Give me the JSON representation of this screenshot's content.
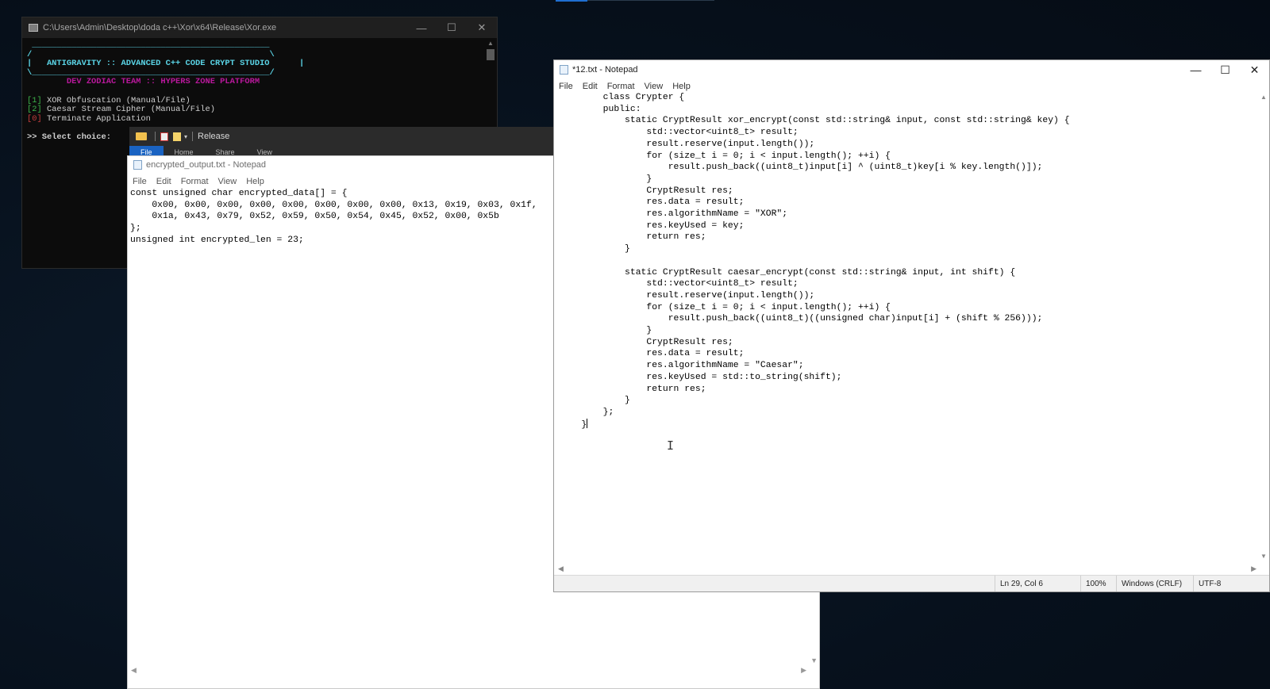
{
  "console": {
    "title": "C:\\Users\\Admin\\Desktop\\doda c++\\Xor\\x64\\Release\\Xor.exe",
    "banner_top": " ________________________________________________ ",
    "banner_line": "/                                                \\",
    "banner_title": "|   ANTIGRAVITY :: ADVANCED C++ CODE CRYPT STUDIO      |",
    "banner_bottom": "\\________________________________________________/",
    "subtitle": "        DEV ZODIAC TEAM :: HYPERS ZONE PLATFORM",
    "options": [
      {
        "key": "[1]",
        "label": " XOR Obfuscation (Manual/File)"
      },
      {
        "key": "[2]",
        "label": " Caesar Stream Cipher (Manual/File)"
      },
      {
        "key": "[0]",
        "label": " Terminate Application"
      }
    ],
    "prompt": ">> Select choice:"
  },
  "explorer": {
    "title": "Release",
    "tabs": [
      "File",
      "Home",
      "Share",
      "View"
    ]
  },
  "notepad_output": {
    "title": "encrypted_output.txt - Notepad",
    "menu": [
      "File",
      "Edit",
      "Format",
      "View",
      "Help"
    ],
    "content": "const unsigned char encrypted_data[] = {\n    0x00, 0x00, 0x00, 0x00, 0x00, 0x00, 0x00, 0x00, 0x13, 0x19, 0x03, 0x1f,\n    0x1a, 0x43, 0x79, 0x52, 0x59, 0x50, 0x54, 0x45, 0x52, 0x00, 0x5b\n};\nunsigned int encrypted_len = 23;"
  },
  "notepad_code": {
    "title": "*12.txt - Notepad",
    "menu": [
      "File",
      "Edit",
      "Format",
      "View",
      "Help"
    ],
    "content": "        class Crypter {\n        public:\n            static CryptResult xor_encrypt(const std::string& input, const std::string& key) {\n                std::vector<uint8_t> result;\n                result.reserve(input.length());\n                for (size_t i = 0; i < input.length(); ++i) {\n                    result.push_back((uint8_t)input[i] ^ (uint8_t)key[i % key.length()]);\n                }\n                CryptResult res;\n                res.data = result;\n                res.algorithmName = \"XOR\";\n                res.keyUsed = key;\n                return res;\n            }\n\n            static CryptResult caesar_encrypt(const std::string& input, int shift) {\n                std::vector<uint8_t> result;\n                result.reserve(input.length());\n                for (size_t i = 0; i < input.length(); ++i) {\n                    result.push_back((uint8_t)((unsigned char)input[i] + (shift % 256)));\n                }\n                CryptResult res;\n                res.data = result;\n                res.algorithmName = \"Caesar\";\n                res.keyUsed = std::to_string(shift);\n                return res;\n            }\n        };\n    }",
    "status": {
      "position": "Ln 29, Col 6",
      "zoom": "100%",
      "line_endings": "Windows (CRLF)",
      "encoding": "UTF-8"
    }
  }
}
